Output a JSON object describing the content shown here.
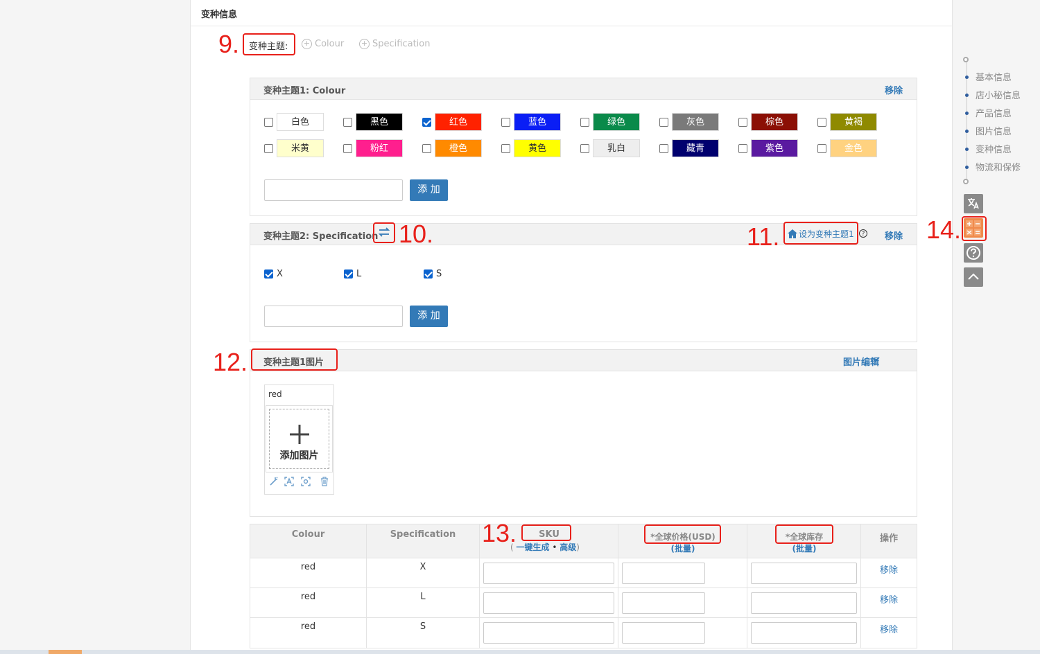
{
  "section_title": "变种信息",
  "annotations": {
    "a9": "9.",
    "a10": "10.",
    "a11": "11.",
    "a12": "12.",
    "a13": "13.",
    "a14": "14."
  },
  "theme_selector": {
    "label": "变种主题:",
    "options": [
      "Colour",
      "Specification"
    ]
  },
  "theme1": {
    "title": "变种主题1:  Colour",
    "remove": "移除",
    "add_button": "添 加",
    "colors": [
      {
        "label": "白色",
        "bg": "#ffffff",
        "fg": "#333333",
        "checked": false
      },
      {
        "label": "黑色",
        "bg": "#000000",
        "fg": "#ffffff",
        "checked": false
      },
      {
        "label": "红色",
        "bg": "#ff2200",
        "fg": "#ffffff",
        "checked": true
      },
      {
        "label": "蓝色",
        "bg": "#0a1ef5",
        "fg": "#ffffff",
        "checked": false
      },
      {
        "label": "绿色",
        "bg": "#0a8a4a",
        "fg": "#ffffff",
        "checked": false
      },
      {
        "label": "灰色",
        "bg": "#7a7a7a",
        "fg": "#ffffff",
        "checked": false
      },
      {
        "label": "棕色",
        "bg": "#8b0f05",
        "fg": "#ffffff",
        "checked": false
      },
      {
        "label": "黄褐",
        "bg": "#8f8a00",
        "fg": "#ffffff",
        "checked": false
      },
      {
        "label": "米黄",
        "bg": "#ffffcc",
        "fg": "#333333",
        "checked": false
      },
      {
        "label": "粉红",
        "bg": "#ff1f8e",
        "fg": "#ffffff",
        "checked": false
      },
      {
        "label": "橙色",
        "bg": "#ff8a00",
        "fg": "#ffffff",
        "checked": false
      },
      {
        "label": "黄色",
        "bg": "#ffff00",
        "fg": "#333333",
        "checked": false
      },
      {
        "label": "乳白",
        "bg": "#eeeeee",
        "fg": "#333333",
        "checked": false
      },
      {
        "label": "藏青",
        "bg": "#00006e",
        "fg": "#ffffff",
        "checked": false
      },
      {
        "label": "紫色",
        "bg": "#5a1aa0",
        "fg": "#ffffff",
        "checked": false
      },
      {
        "label": "金色",
        "bg": "#ffd280",
        "fg": "#ffffff",
        "checked": false
      }
    ]
  },
  "theme2": {
    "title": "变种主题2:  Specification",
    "set_main": "设为变种主题1",
    "remove": "移除",
    "add_button": "添 加",
    "options": [
      {
        "label": "X",
        "checked": true
      },
      {
        "label": "L",
        "checked": true
      },
      {
        "label": "S",
        "checked": true
      }
    ]
  },
  "theme_image": {
    "title": "变种主题1图片",
    "edit": "图片编辑",
    "card_label": "red",
    "add_image": "添加图片"
  },
  "table": {
    "headers": {
      "colour": "Colour",
      "spec": "Specification",
      "sku": "SKU",
      "sku_gen": "一键生成",
      "sku_sep": "•",
      "sku_adv": "高级",
      "price": "*全球价格(USD)",
      "price_batch": "(批量)",
      "stock": "*全球库存",
      "stock_batch": "(批量)",
      "action": "操作"
    },
    "rows": [
      {
        "colour": "red",
        "spec": "X",
        "action": "移除"
      },
      {
        "colour": "red",
        "spec": "L",
        "action": "移除"
      },
      {
        "colour": "red",
        "spec": "S",
        "action": "移除"
      }
    ]
  },
  "side_nav": [
    "基本信息",
    "店小秘信息",
    "产品信息",
    "图片信息",
    "变种信息",
    "物流和保修"
  ]
}
